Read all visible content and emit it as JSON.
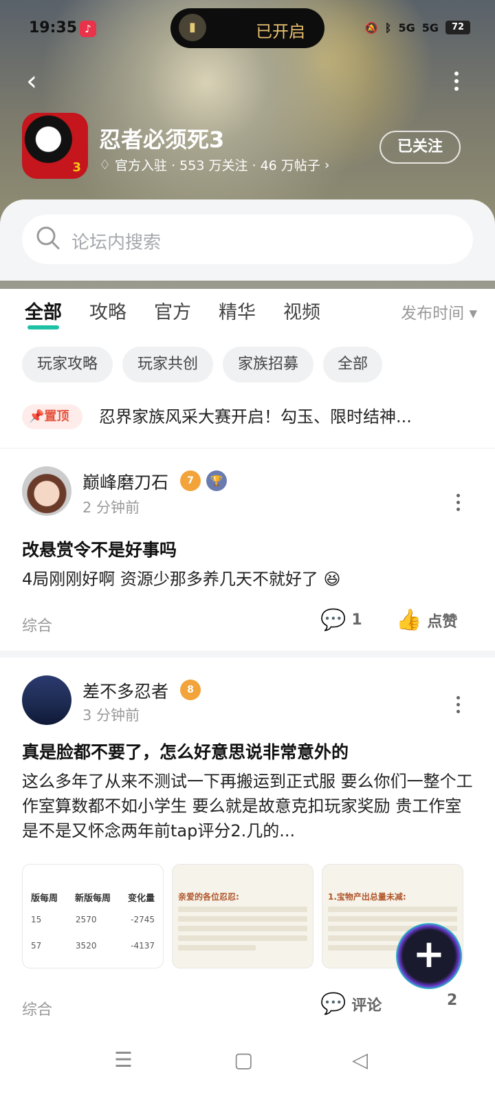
{
  "status": {
    "time": "19:35",
    "flashlight": "已开启",
    "battery": "72",
    "net1": "5G",
    "net2": "5G"
  },
  "header": {
    "game_name": "忍者必须死3",
    "meta": "官方入驻 · 553 万关注 · 46 万帖子",
    "follow_label": "已关注",
    "app_icon_badge": "3"
  },
  "search": {
    "placeholder": "论坛内搜索"
  },
  "tabs": [
    {
      "label": "全部"
    },
    {
      "label": "攻略"
    },
    {
      "label": "官方"
    },
    {
      "label": "精华"
    },
    {
      "label": "视频"
    }
  ],
  "sort_label": "发布时间",
  "chips": [
    {
      "label": "玩家攻略"
    },
    {
      "label": "玩家共创"
    },
    {
      "label": "家族招募"
    },
    {
      "label": "全部"
    }
  ],
  "pinned": {
    "badge": "置顶",
    "text": "忍界家族风采大赛开启！勾玉、限时结神..."
  },
  "posts": [
    {
      "user": "巅峰磨刀石",
      "level": "7",
      "time": "2 分钟前",
      "title": "改悬赏令不是好事吗",
      "body": "4局刚刚好啊 资源少那多养几天不就好了 😆",
      "tag": "综合",
      "comments": "1",
      "like_label": "点赞"
    },
    {
      "user": "差不多忍者",
      "level": "8",
      "time": "3 分钟前",
      "title": "真是脸都不要了，怎么好意思说非常意外的",
      "body": "这么多年了从来不测试一下再搬运到正式服 要么你们一整个工作室算数都不如小学生 要么就是故意克扣玩家奖励 贵工作室是不是又怀念两年前tap评分2.几的...",
      "tag": "综合",
      "comment_label": "评论",
      "likes": "2",
      "thumb_table": {
        "headers": [
          "版每周",
          "新版每周",
          "变化量"
        ],
        "rows": [
          [
            "15",
            "2570",
            "-2745"
          ],
          [
            "57",
            "3520",
            "-4137"
          ]
        ]
      },
      "thumb2_title": "亲爱的各位忍忍:",
      "thumb3_title": "1.宝物产出总量未减:"
    }
  ],
  "fab_label": "+"
}
